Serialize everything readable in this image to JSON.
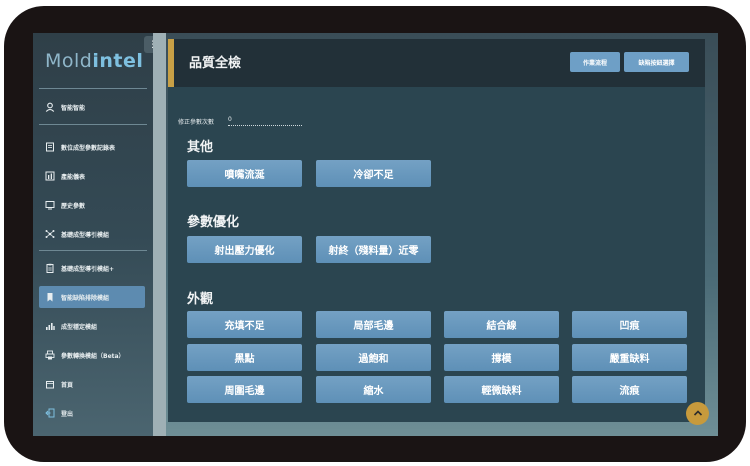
{
  "app": {
    "logo_light": "Mold",
    "logo_bold": "intel",
    "collapse_glyph": "⋮"
  },
  "sidebar": {
    "items": [
      {
        "label": "智能智能",
        "icon": "user-icon"
      },
      {
        "label": "數位成型參數記錄表",
        "icon": "document-icon"
      },
      {
        "label": "產能儀表",
        "icon": "chart-icon"
      },
      {
        "label": "歷史參數",
        "icon": "history-icon"
      },
      {
        "label": "基礎成型導引模組",
        "icon": "network-icon"
      },
      {
        "label": "基礎成型導引模組+",
        "icon": "clipboard-icon"
      },
      {
        "label": "智能缺陷排除模組",
        "icon": "bookmark-icon"
      },
      {
        "label": "成型穩定模組",
        "icon": "bar-chart-icon"
      },
      {
        "label": "參數轉換模組（Beta）",
        "icon": "printer-icon"
      },
      {
        "label": "首頁",
        "icon": "home-icon"
      },
      {
        "label": "登出",
        "icon": "logout-icon"
      }
    ]
  },
  "header": {
    "title": "品質全檢",
    "buttons": [
      "作業流程",
      "缺陷按鈕選擇"
    ]
  },
  "params": {
    "label": "修正參數次數",
    "value": "0"
  },
  "sections": [
    {
      "title": "其他",
      "chips": [
        "噴嘴流涎",
        "冷卻不足"
      ]
    },
    {
      "title": "參數優化",
      "chips": [
        "射出壓力優化",
        "射終（殘料量）近零"
      ]
    },
    {
      "title": "外觀",
      "chips": [
        "充填不足",
        "局部毛邊",
        "結合線",
        "凹痕",
        "黑點",
        "過飽和",
        "撐模",
        "嚴重缺料",
        "周圍毛邊",
        "縮水",
        "輕微缺料",
        "流痕"
      ]
    }
  ],
  "colors": {
    "accent": "#c8a046",
    "chip": "#6e9fc6",
    "active_nav": "#5d8bb0",
    "scroll_button": "#c79a3c"
  }
}
